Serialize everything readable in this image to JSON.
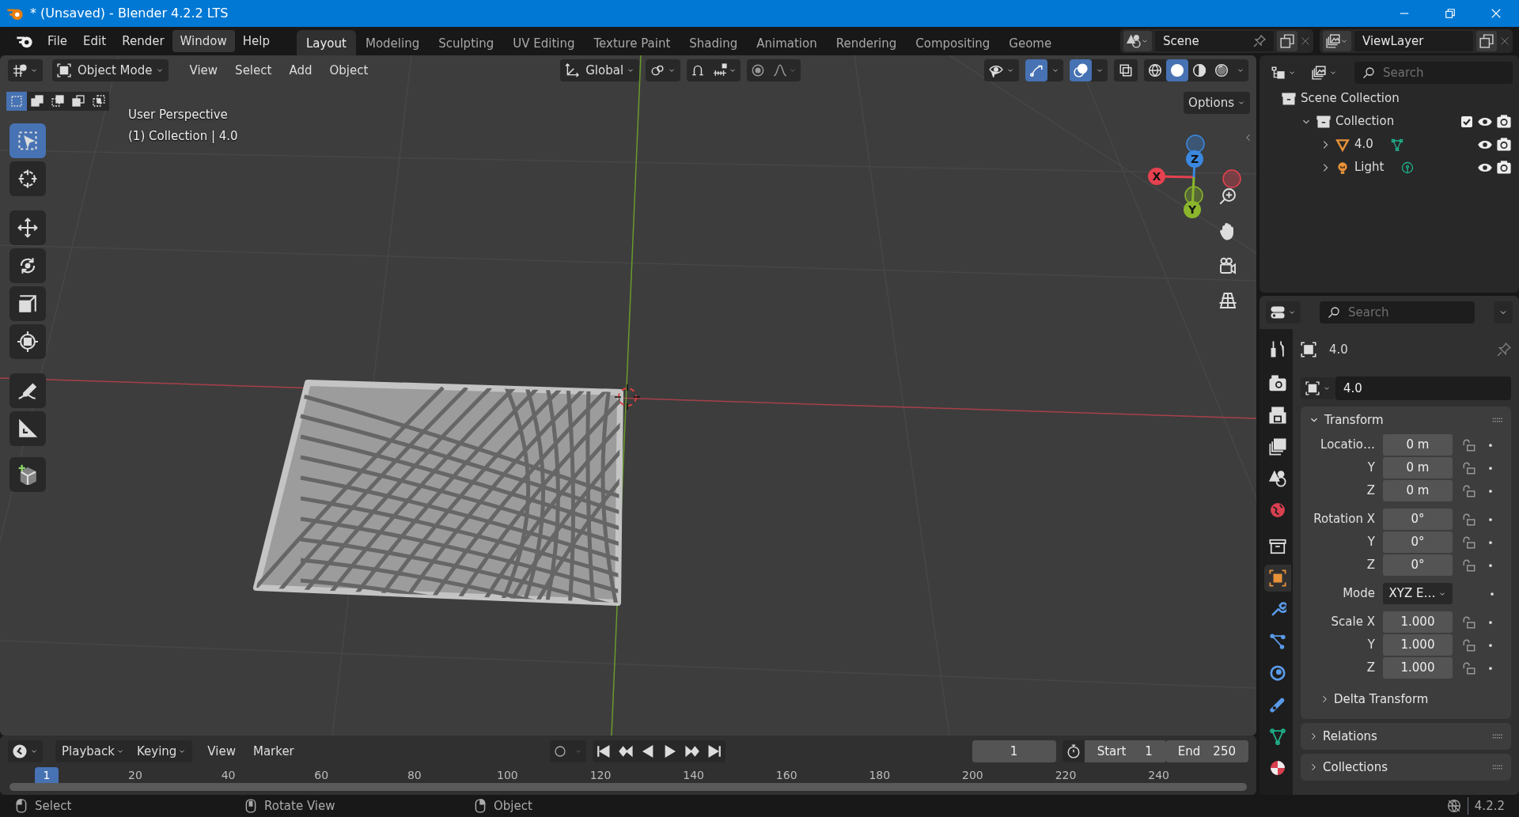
{
  "window": {
    "title": "* (Unsaved) - Blender 4.2.2 LTS"
  },
  "menu": [
    {
      "label": "File",
      "selected": false
    },
    {
      "label": "Edit",
      "selected": false
    },
    {
      "label": "Render",
      "selected": false
    },
    {
      "label": "Window",
      "selected": true
    },
    {
      "label": "Help",
      "selected": false
    }
  ],
  "workspaces": [
    {
      "label": "Layout",
      "selected": true
    },
    {
      "label": "Modeling",
      "selected": false
    },
    {
      "label": "Sculpting",
      "selected": false
    },
    {
      "label": "UV Editing",
      "selected": false
    },
    {
      "label": "Texture Paint",
      "selected": false
    },
    {
      "label": "Shading",
      "selected": false
    },
    {
      "label": "Animation",
      "selected": false
    },
    {
      "label": "Rendering",
      "selected": false
    },
    {
      "label": "Compositing",
      "selected": false
    },
    {
      "label": "Geome",
      "selected": false
    }
  ],
  "scene": "Scene",
  "view_layer": "ViewLayer",
  "viewport": {
    "mode": "Object Mode",
    "menus": [
      "View",
      "Select",
      "Add",
      "Object"
    ],
    "orientation": "Global",
    "gizmos_on": true,
    "overlays_on": true,
    "shading": [
      {
        "kind": "wireframe",
        "selected": false
      },
      {
        "kind": "solid",
        "selected": true
      },
      {
        "kind": "material",
        "selected": false
      },
      {
        "kind": "rendered",
        "selected": false
      }
    ],
    "options": "Options",
    "select_modes": [
      {
        "kind": "set",
        "selected": true
      },
      {
        "kind": "extend",
        "selected": false
      },
      {
        "kind": "subtract",
        "selected": false
      },
      {
        "kind": "invert",
        "selected": false
      },
      {
        "kind": "intersect",
        "selected": false
      }
    ],
    "tools": [
      {
        "kind": "select_box",
        "selected": true
      },
      {
        "kind": "cursor",
        "selected": false
      },
      {
        "kind": "move",
        "selected": false
      },
      {
        "kind": "rotate",
        "selected": false
      },
      {
        "kind": "scale",
        "selected": false
      },
      {
        "kind": "transform",
        "selected": false
      },
      {
        "kind": "annotate",
        "selected": false
      },
      {
        "kind": "measure",
        "selected": false
      },
      {
        "kind": "add_cube",
        "selected": false
      }
    ],
    "info": [
      "User Perspective",
      "(1) Collection | 4.0"
    ],
    "axes": [
      {
        "label": "X",
        "color": "#e5414f"
      },
      {
        "label": "Y",
        "color": "#8ab52c"
      },
      {
        "label": "Z",
        "color": "#3b88e0"
      }
    ]
  },
  "outliner": {
    "search_placeholder": "Search",
    "tree": [
      {
        "label": "Scene Collection",
        "kind": "scene_collection",
        "children": [
          {
            "label": "Collection",
            "kind": "collection",
            "expanded": true,
            "checked": true,
            "children": [
              {
                "label": "4.0",
                "kind": "mesh",
                "expanded": false
              },
              {
                "label": "Light",
                "kind": "light",
                "expanded": false
              }
            ]
          }
        ]
      }
    ]
  },
  "properties": {
    "search_placeholder": "Search",
    "tabs": [
      {
        "kind": "tool",
        "selected": false
      },
      {
        "kind": "render",
        "selected": false
      },
      {
        "kind": "output",
        "selected": false
      },
      {
        "kind": "view_layer",
        "selected": false
      },
      {
        "kind": "scene",
        "selected": false
      },
      {
        "kind": "world",
        "selected": false
      },
      {
        "kind": "collection",
        "selected": false
      },
      {
        "kind": "object",
        "selected": true
      },
      {
        "kind": "modifiers",
        "selected": false
      },
      {
        "kind": "particles",
        "selected": false
      },
      {
        "kind": "physics",
        "selected": false
      },
      {
        "kind": "constraints",
        "selected": false
      },
      {
        "kind": "data",
        "selected": false
      },
      {
        "kind": "material",
        "selected": false
      }
    ],
    "object_name": "4.0",
    "name_field": "4.0",
    "transform": {
      "label": "Transform",
      "expanded": true,
      "groups": [
        [
          {
            "label": "Locatio…",
            "value": "0 m",
            "kind": "number"
          },
          {
            "label": "Y",
            "value": "0 m",
            "kind": "number"
          },
          {
            "label": "Z",
            "value": "0 m",
            "kind": "number"
          }
        ],
        [
          {
            "label": "Rotation X",
            "value": "0°",
            "kind": "number"
          },
          {
            "label": "Y",
            "value": "0°",
            "kind": "number"
          },
          {
            "label": "Z",
            "value": "0°",
            "kind": "number"
          }
        ],
        [
          {
            "label": "Mode",
            "value": "XYZ E…",
            "kind": "dropdown"
          }
        ],
        [
          {
            "label": "Scale X",
            "value": "1.000",
            "kind": "number"
          },
          {
            "label": "Y",
            "value": "1.000",
            "kind": "number"
          },
          {
            "label": "Z",
            "value": "1.000",
            "kind": "number"
          }
        ]
      ]
    },
    "subpanels": [
      {
        "label": "Delta Transform",
        "expanded": false
      }
    ],
    "panels": [
      {
        "label": "Relations",
        "expanded": false
      },
      {
        "label": "Collections",
        "expanded": false
      }
    ]
  },
  "timeline": {
    "menus": [
      {
        "label": "Playback",
        "kind": "dropdown"
      },
      {
        "label": "Keying",
        "kind": "dropdown"
      },
      {
        "label": "View",
        "kind": "menu"
      },
      {
        "label": "Marker",
        "kind": "menu"
      }
    ],
    "current_frame": "1",
    "start_label": "Start",
    "start": "1",
    "end_label": "End",
    "end": "250",
    "playhead": "1",
    "ruler": [
      "20",
      "40",
      "60",
      "80",
      "100",
      "120",
      "140",
      "160",
      "180",
      "200",
      "220",
      "240"
    ]
  },
  "status_bar": {
    "hints": [
      {
        "label": "Select",
        "kind": "left"
      },
      {
        "label": "Rotate View",
        "kind": "middle"
      },
      {
        "label": "Object",
        "kind": "right"
      }
    ],
    "version": "4.2.2"
  }
}
